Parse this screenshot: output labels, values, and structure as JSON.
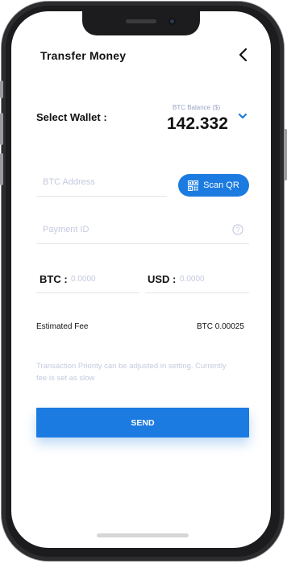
{
  "header": {
    "title": "Transfer Money",
    "back_icon": "chevron-left-icon"
  },
  "wallet": {
    "label": "Select Wallet :",
    "balance_caption": "BTC Balance ($)",
    "balance_value": "142.332",
    "dropdown_icon": "chevron-down-icon"
  },
  "form": {
    "btc_address_placeholder": "BTC Address",
    "scan_button_label": "Scan QR",
    "payment_id_placeholder": "Payment ID",
    "btc_label": "BTC :",
    "btc_placeholder": "0.0000",
    "usd_label": "USD :",
    "usd_placeholder": "0.0000"
  },
  "fee": {
    "label": "Estimated Fee",
    "value": "BTC 0.00025"
  },
  "note": "Transaction Priority can be adjusted in setting. Currently fee is set as slow",
  "send_label": "SEND",
  "colors": {
    "accent": "#1c7be0",
    "placeholder": "#c5c9df",
    "text": "#111111"
  }
}
